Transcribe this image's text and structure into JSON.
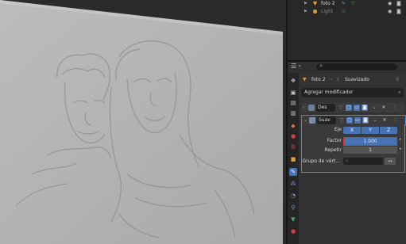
{
  "outliner": {
    "rows": [
      {
        "name": "foto 2"
      },
      {
        "name": "Light"
      }
    ]
  },
  "properties": {
    "breadcrumb_object": "foto 2",
    "breadcrumb_modifier": "Suavizado",
    "add_modifier_label": "Agregar modificador",
    "modifiers": [
      {
        "short_name": "Des"
      },
      {
        "short_name": "Suav"
      }
    ],
    "smooth": {
      "axis_label": "Eje",
      "axis_x": "X",
      "axis_y": "Y",
      "axis_z": "Z",
      "factor_label": "Factor",
      "factor_value": "1.000",
      "repeat_label": "Repetir",
      "repeat_value": "1",
      "vertex_group_label": "Grupo de vért..."
    }
  },
  "colors": {
    "accent": "#4772b3",
    "highlight_box": "#e03030",
    "panel_bg": "#333333"
  },
  "icons": {
    "search": "magnifier",
    "pin": "pin",
    "wrench_tab": "wrench"
  }
}
